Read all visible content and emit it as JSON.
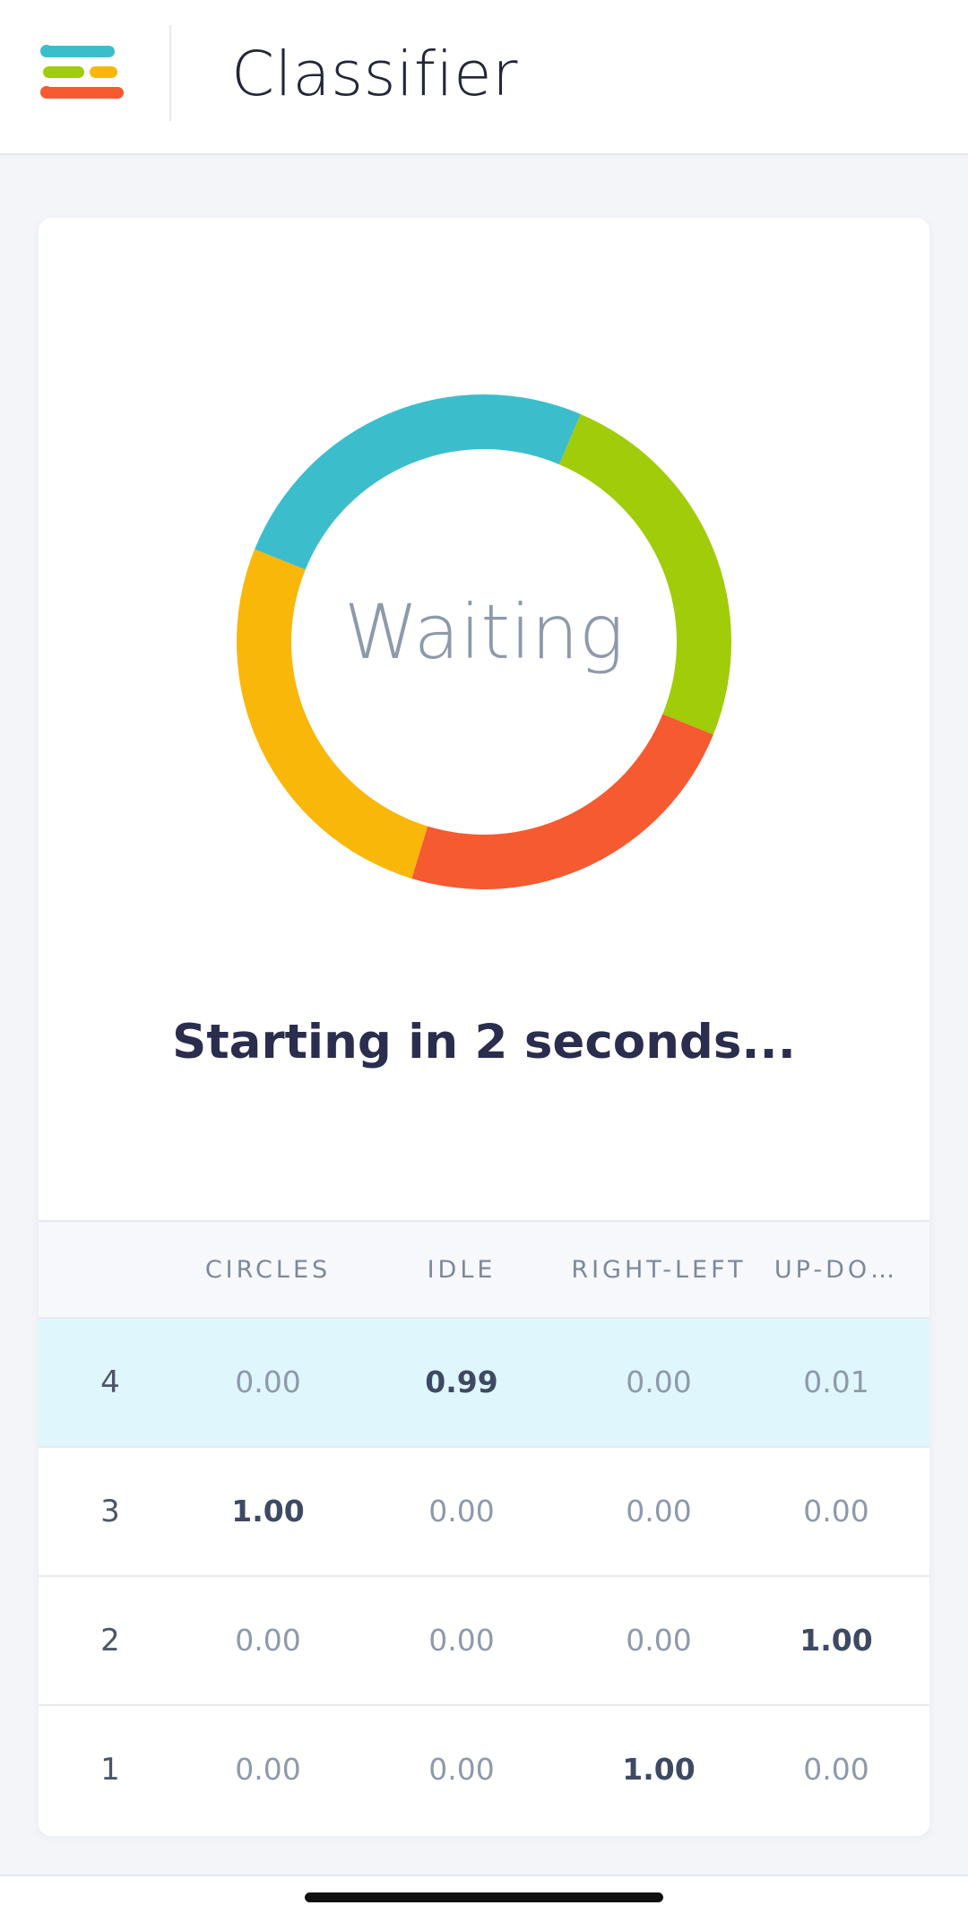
{
  "header": {
    "title": "Classifier",
    "menu_icon": "menu-stack-icon",
    "menu_icon_colors": [
      "#3cbdcc",
      "#a0cc0a",
      "#f9b70a",
      "#f55a30"
    ]
  },
  "status": {
    "donut_label": "Waiting",
    "message": "Starting in 2 seconds..."
  },
  "ring": {
    "segments": [
      {
        "color": "#3cbdcc"
      },
      {
        "color": "#a0cc0a"
      },
      {
        "color": "#f55a30"
      },
      {
        "color": "#f9b70a"
      }
    ]
  },
  "table": {
    "columns": [
      "",
      "CIRCLES",
      "IDLE",
      "RIGHT-LEFT",
      "UP-DO…"
    ],
    "rows": [
      {
        "index": "4",
        "values": [
          "0.00",
          "0.99",
          "0.00",
          "0.01"
        ],
        "highlight": [
          false,
          true,
          false,
          false
        ],
        "active": true
      },
      {
        "index": "3",
        "values": [
          "1.00",
          "0.00",
          "0.00",
          "0.00"
        ],
        "highlight": [
          true,
          false,
          false,
          false
        ],
        "active": false
      },
      {
        "index": "2",
        "values": [
          "0.00",
          "0.00",
          "0.00",
          "1.00"
        ],
        "highlight": [
          false,
          false,
          false,
          true
        ],
        "active": false
      },
      {
        "index": "1",
        "values": [
          "0.00",
          "0.00",
          "1.00",
          "0.00"
        ],
        "highlight": [
          false,
          false,
          true,
          false
        ],
        "active": false
      }
    ]
  },
  "colors": {
    "active_row": "#dff6fc",
    "title_text": "#23263a",
    "status_text": "#2b2d4e"
  }
}
